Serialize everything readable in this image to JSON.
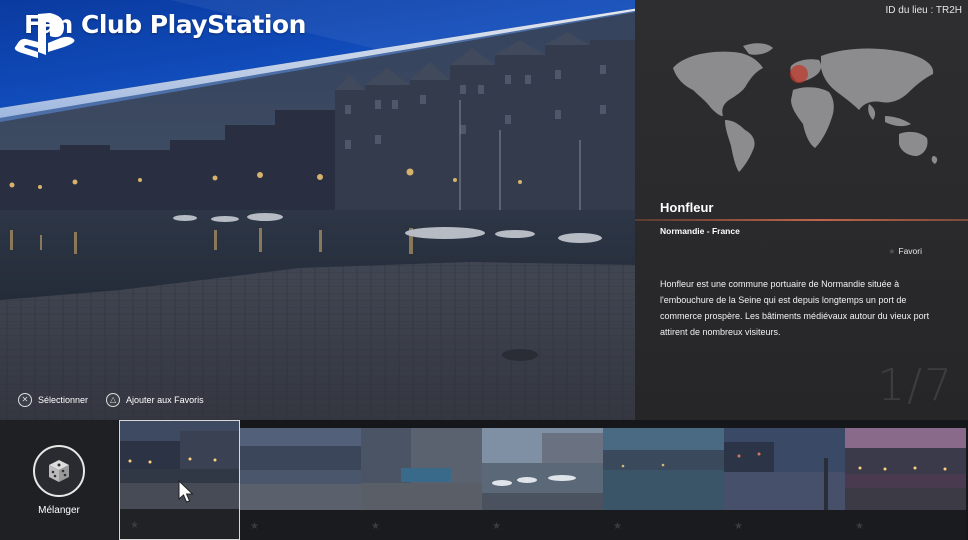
{
  "header": {
    "title": "Fan Club PlayStation",
    "logo_icon": "playstation-logo-icon",
    "accent_color": "#0a3fa8"
  },
  "panel": {
    "place_id": "ID du lieu : TR2H",
    "place_name": "Honfleur",
    "region": "Normandie - France",
    "favorite_label": "Favori",
    "description": "Honfleur est une commune portuaire de Normandie située à l'embouchure de la Seine qui est depuis longtemps un port de commerce prospère. Les bâtiments médiévaux autour du vieux port attirent de nombreux visiteurs.",
    "counter": "1/7",
    "map_highlight_color": "#c0392b"
  },
  "hints": {
    "select_label": "Sélectionner",
    "select_icon": "cross-button-icon",
    "favorite_label": "Ajouter aux Favoris",
    "favorite_icon": "triangle-button-icon"
  },
  "strip": {
    "shuffle_label": "Mélanger",
    "shuffle_icon": "dice-icon",
    "selected_index": 0,
    "thumbnails": [
      {
        "scene": "harbor-dusk"
      },
      {
        "scene": "harbor-wide"
      },
      {
        "scene": "street-houses"
      },
      {
        "scene": "boats-church"
      },
      {
        "scene": "marina-evening"
      },
      {
        "scene": "quay-fog"
      },
      {
        "scene": "waterfront-sunset"
      }
    ]
  }
}
